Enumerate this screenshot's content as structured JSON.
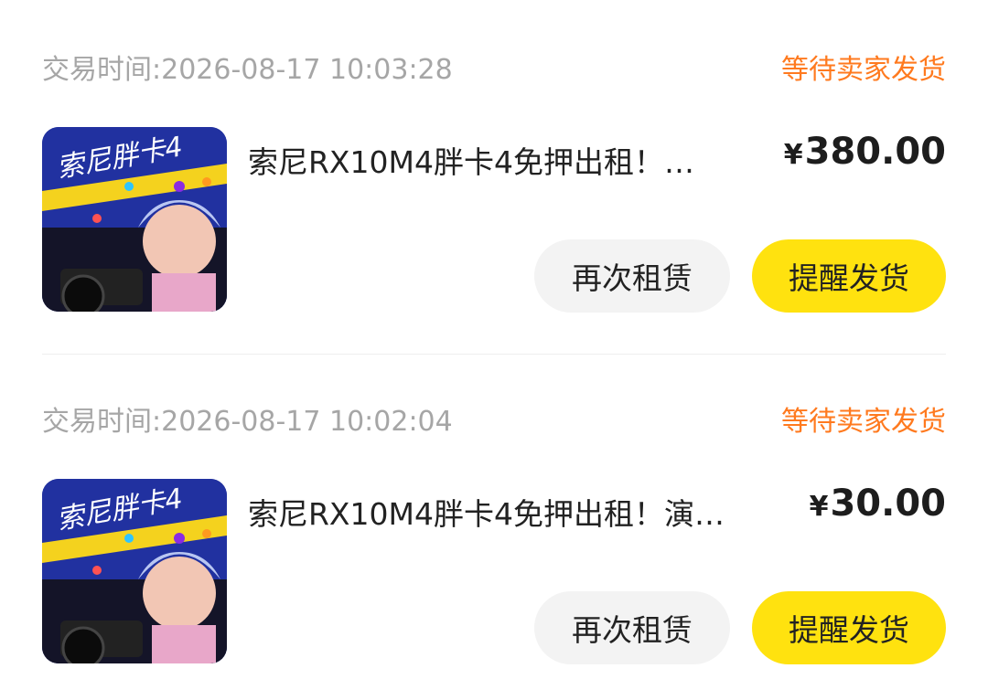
{
  "orders": [
    {
      "time_label": "交易时间:2026-08-17 10:03:28",
      "status": "等待卖家发货",
      "title": "索尼RX10M4胖卡4免押出租！…",
      "currency": "¥",
      "price": "380.00",
      "rent_again_label": "再次租赁",
      "remind_label": "提醒发货",
      "thumb_text": "索尼胖卡4"
    },
    {
      "time_label": "交易时间:2026-08-17 10:02:04",
      "status": "等待卖家发货",
      "title": "索尼RX10M4胖卡4免押出租！演…",
      "currency": "¥",
      "price": "30.00",
      "rent_again_label": "再次租赁",
      "remind_label": "提醒发货",
      "thumb_text": "索尼胖卡4"
    }
  ],
  "colors": {
    "status": "#ff7a1f",
    "remind_button": "#ffe20f",
    "rent_button": "#f3f3f3"
  }
}
